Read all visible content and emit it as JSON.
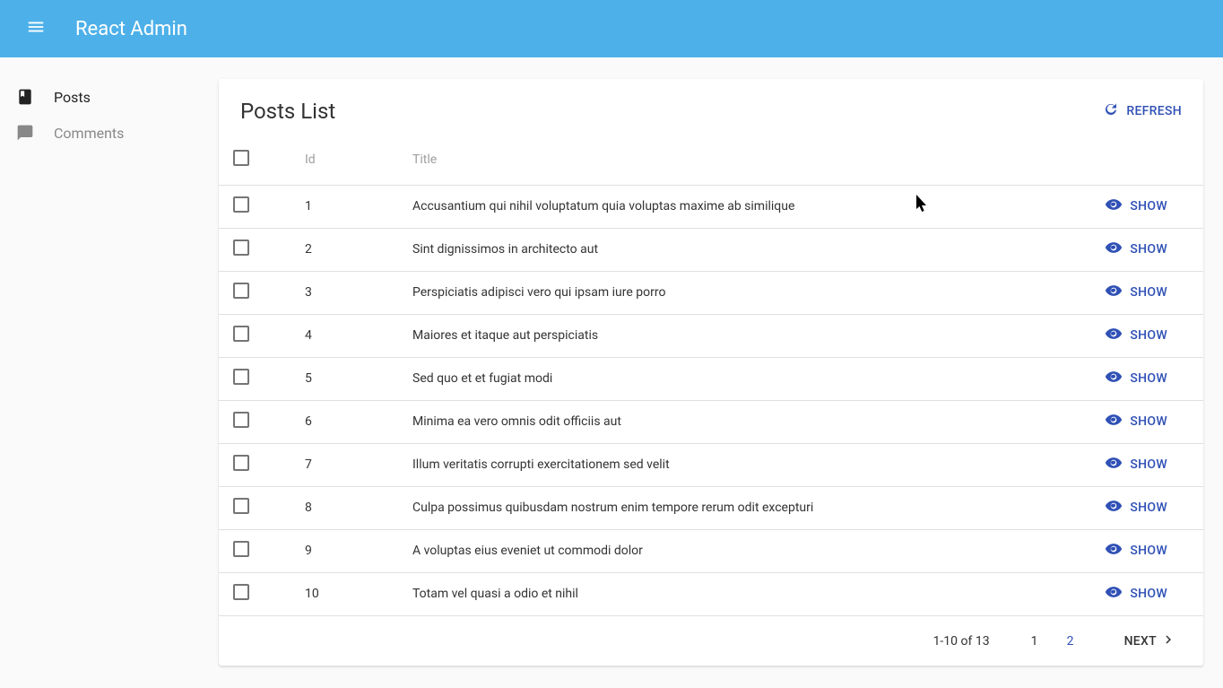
{
  "app": {
    "title": "React Admin"
  },
  "sidebar": {
    "items": [
      {
        "label": "Posts",
        "active": true,
        "icon": "book"
      },
      {
        "label": "Comments",
        "active": false,
        "icon": "chat"
      }
    ]
  },
  "page": {
    "title": "Posts List",
    "refresh_label": "REFRESH",
    "columns": {
      "id": "Id",
      "title": "Title"
    },
    "show_label": "SHOW",
    "rows": [
      {
        "id": "1",
        "title": "Accusantium qui nihil voluptatum quia voluptas maxime ab similique"
      },
      {
        "id": "2",
        "title": "Sint dignissimos in architecto aut"
      },
      {
        "id": "3",
        "title": "Perspiciatis adipisci vero qui ipsam iure porro"
      },
      {
        "id": "4",
        "title": "Maiores et itaque aut perspiciatis"
      },
      {
        "id": "5",
        "title": "Sed quo et et fugiat modi"
      },
      {
        "id": "6",
        "title": "Minima ea vero omnis odit officiis aut"
      },
      {
        "id": "7",
        "title": "Illum veritatis corrupti exercitationem sed velit"
      },
      {
        "id": "8",
        "title": "Culpa possimus quibusdam nostrum enim tempore rerum odit excepturi"
      },
      {
        "id": "9",
        "title": "A voluptas eius eveniet ut commodi dolor"
      },
      {
        "id": "10",
        "title": "Totam vel quasi a odio et nihil"
      }
    ],
    "pagination": {
      "range": "1-10 of 13",
      "pages": [
        "1",
        "2"
      ],
      "current_page": "1",
      "next_label": "NEXT"
    }
  },
  "colors": {
    "primary": "#4db0e9",
    "accent": "#2f50b5"
  }
}
